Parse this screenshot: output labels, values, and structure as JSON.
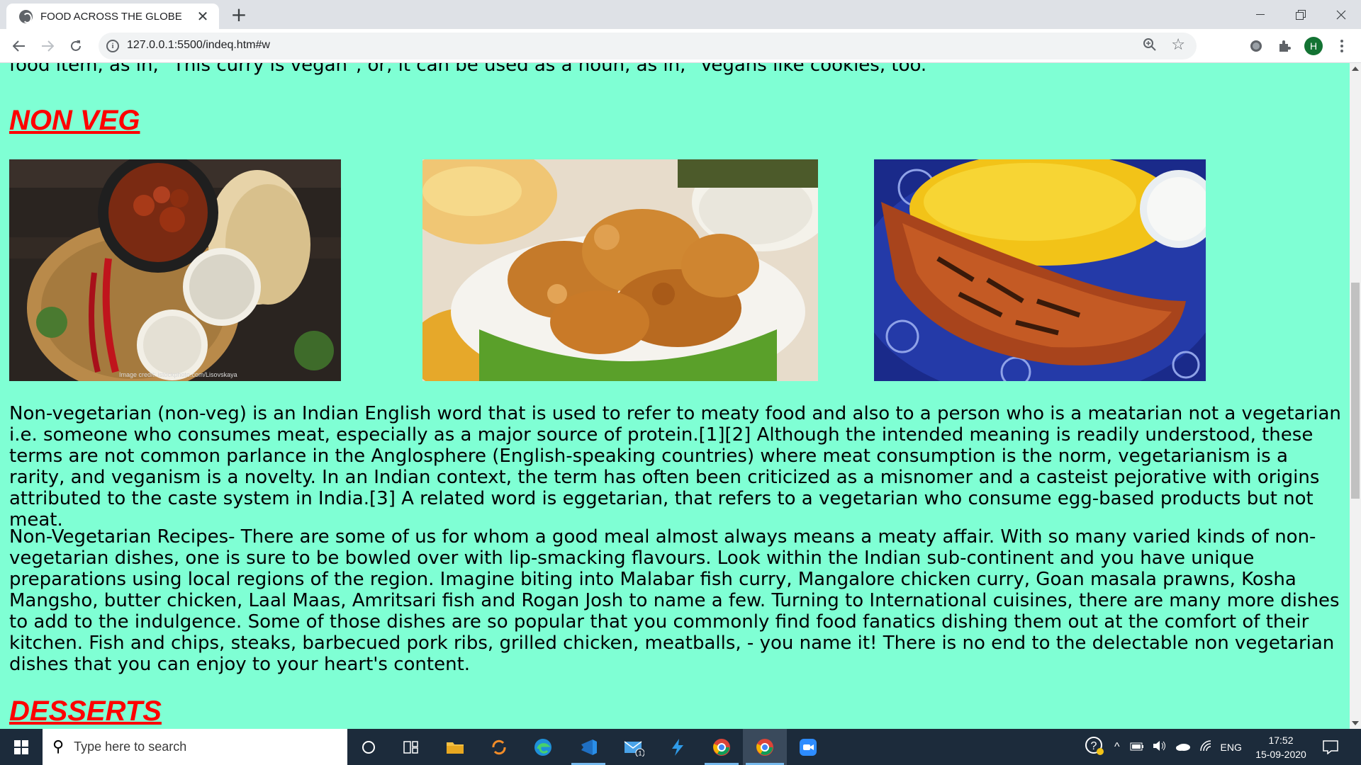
{
  "browser": {
    "tab_title": "FOOD ACROSS THE GLOBE",
    "url": "127.0.0.1:5500/indeq.htm#w",
    "profile_initial": "H",
    "icons": [
      "back-arrow-icon",
      "forward-arrow-icon",
      "reload-icon",
      "info-icon",
      "zoom-icon",
      "star-icon",
      "extension-icon",
      "puzzle-icon",
      "menu-icon"
    ]
  },
  "page": {
    "background": "#7fffd4",
    "heading_color": "#ff0000",
    "top_paragraph": "food item, as in, \"This curry is vegan\", or, it can be used as a noun, as in, \"Vegans like cookies, too.\"",
    "nonveg_heading": "NON VEG",
    "images": [
      "tandoori-curry-platter",
      "fried-chicken",
      "grilled-chicken-rice"
    ],
    "image_credit": "Image credit: istockphoto.com/Lisovskaya",
    "para1": "Non-vegetarian (non-veg) is an Indian English word that is used to refer to meaty food and also to a person who is a meatarian not a vegetarian i.e. someone who consumes meat, especially as a major source of protein.[1][2] Although the intended meaning is readily understood, these terms are not common parlance in the Anglosphere (English-speaking countries) where meat consumption is the norm, vegetarianism is a rarity, and veganism is a novelty. In an Indian context, the term has often been criticized as a misnomer and a casteist pejorative with origins attributed to the caste system in India.[3] A related word is eggetarian, that refers to a vegetarian who consume egg-based products but not meat.",
    "para2": "Non-Vegetarian Recipes- There are some of us for whom a good meal almost always means a meaty affair. With so many varied kinds of non-vegetarian dishes, one is sure to be bowled over with lip-smacking flavours. Look within the Indian sub-continent and you have unique preparations using local regions of the region. Imagine biting into Malabar fish curry, Mangalore chicken curry, Goan masala prawns, Kosha Mangsho, butter chicken, Laal Maas, Amritsari fish and Rogan Josh to name a few. Turning to International cuisines, there are many more dishes to add to the indulgence. Some of those dishes are so popular that you commonly find food fanatics dishing them out at the comfort of their kitchen. Fish and chips, steaks, barbecued pork ribs, grilled chicken, meatballs, - you name it! There is no end to the delectable non vegetarian dishes that you can enjoy to your heart's content.",
    "desserts_heading": "DESSERTS"
  },
  "taskbar": {
    "search_placeholder": "Type here to search",
    "mail_badge": "1",
    "language": "ENG",
    "time": "17:52",
    "date": "15-09-2020"
  }
}
